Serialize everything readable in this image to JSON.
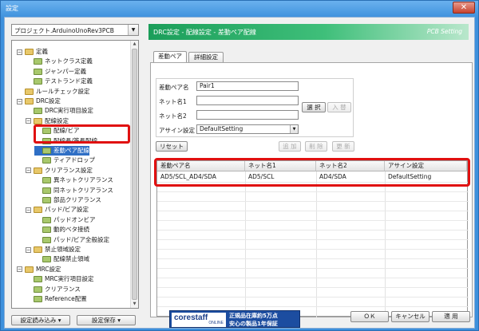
{
  "window": {
    "title": "設定",
    "close_label": "✕"
  },
  "project": {
    "selected": "プロジェクト.ArduinoUnoRev3PCB"
  },
  "tree": [
    {
      "label": "定義",
      "toggle": "−",
      "icon": "folder"
    },
    {
      "label": "ネットクラス定義",
      "icon": "folder-green"
    },
    {
      "label": "ジャンパー定義",
      "icon": "folder-green"
    },
    {
      "label": "テストランド定義",
      "icon": "folder-green"
    },
    {
      "label": "ルールチェック設定",
      "icon": "folder"
    },
    {
      "label": "DRC設定",
      "toggle": "−",
      "icon": "folder"
    },
    {
      "label": "DRC実行項目設定",
      "icon": "folder-green"
    },
    {
      "label": "配線設定",
      "toggle": "−",
      "icon": "folder"
    },
    {
      "label": "配線/ビア",
      "icon": "folder-green"
    },
    {
      "label": "配線長/等長配線",
      "icon": "folder-green"
    },
    {
      "label": "差動ペア配線",
      "icon": "folder-green"
    },
    {
      "label": "ティアドロップ",
      "icon": "folder-green"
    },
    {
      "label": "クリアランス設定",
      "toggle": "−",
      "icon": "folder"
    },
    {
      "label": "異ネットクリアランス",
      "icon": "folder-green"
    },
    {
      "label": "同ネットクリアランス",
      "icon": "folder-green"
    },
    {
      "label": "部品クリアランス",
      "icon": "folder-green"
    },
    {
      "label": "パッド/ビア設定",
      "toggle": "−",
      "icon": "folder"
    },
    {
      "label": "パッドオンビア",
      "icon": "folder-green"
    },
    {
      "label": "動的ベタ接続",
      "icon": "folder-green"
    },
    {
      "label": "パッド/ビア全般設定",
      "icon": "folder-green"
    },
    {
      "label": "禁止領域設定",
      "toggle": "−",
      "icon": "folder"
    },
    {
      "label": "配線禁止領域",
      "icon": "folder-green"
    },
    {
      "label": "MRC設定",
      "toggle": "−",
      "icon": "folder"
    },
    {
      "label": "MRC実行項目設定",
      "icon": "folder-green"
    },
    {
      "label": "クリアランス",
      "icon": "folder-green"
    },
    {
      "label": "Reference配置",
      "icon": "folder-green"
    }
  ],
  "left_buttons": {
    "load": "設定読み込み ▾",
    "save": "設定保存 ▾"
  },
  "banner": {
    "title": "DRC設定 - 配線設定 - 差動ペア配線",
    "subtitle": "PCB Setting"
  },
  "tabs": [
    "差動ペア",
    "詳細設定"
  ],
  "form": {
    "pair_name_label": "差動ペア名",
    "pair_name_value": "Pair1",
    "net1_label": "ネット名1",
    "net1_value": "",
    "net2_label": "ネット名2",
    "net2_value": "",
    "assign_label": "アサイン設定",
    "assign_value": "DefaultSetting",
    "select_btn": "選 択",
    "enter_btn": "入 替"
  },
  "actions": {
    "reset": "リセット",
    "add": "追 加",
    "delete": "削 除",
    "update": "更 新"
  },
  "table": {
    "columns": [
      "差動ペア名",
      "ネット名1",
      "ネット名2",
      "アサイン設定"
    ],
    "rows": [
      [
        "AD5/SCL_AD4/SDA",
        "AD5/SCL",
        "AD4/SDA",
        "DefaultSetting"
      ]
    ]
  },
  "ad": {
    "logo": "corestaff",
    "logo_sub": "ONLINE",
    "line1": "正規品在庫約5万点",
    "line2": "安心の製品1年保証"
  },
  "footer": {
    "ok": "ＯＫ",
    "cancel": "キャンセル",
    "apply": "適 用"
  },
  "colors": {
    "banner": "#1b9e5a",
    "highlight": "#e01010",
    "selection": "#2f6fc5"
  }
}
